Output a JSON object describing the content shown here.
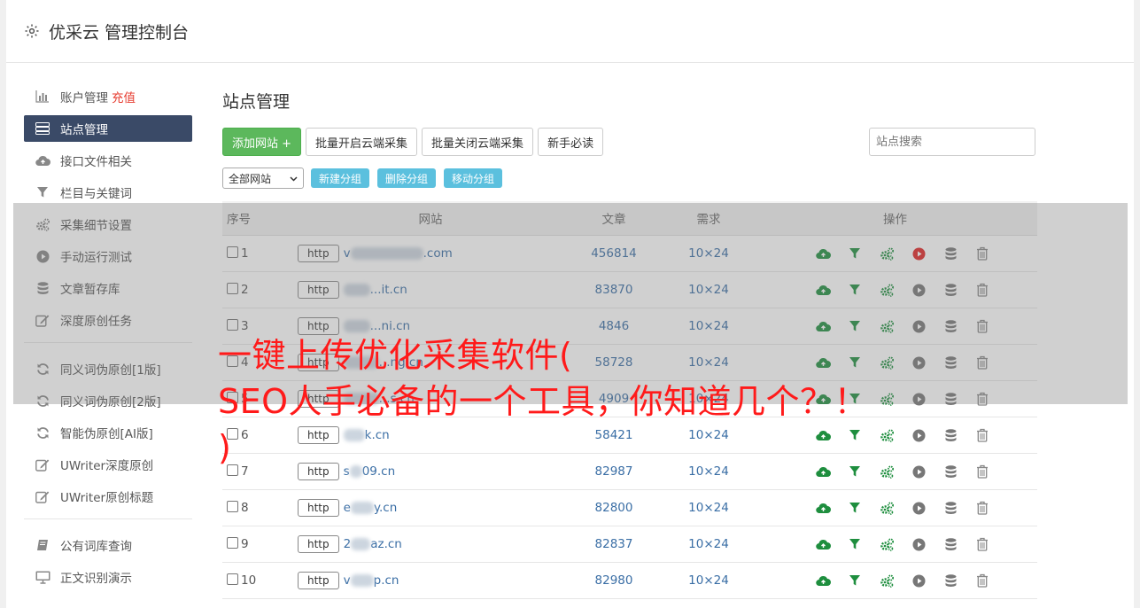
{
  "app": {
    "title": "优采云 管理控制台",
    "icon": "gear-icon"
  },
  "sidebar": {
    "groups": [
      [
        {
          "label": "账户管理",
          "tag": "充值",
          "icon": "bar-chart-icon"
        },
        {
          "label": "站点管理",
          "icon": "server-icon",
          "active": true
        },
        {
          "label": "接口文件相关",
          "icon": "cloud-upload-icon"
        },
        {
          "label": "栏目与关键词",
          "icon": "filter-icon"
        },
        {
          "label": "采集细节设置",
          "icon": "gears-icon"
        },
        {
          "label": "手动运行测试",
          "icon": "play-icon"
        },
        {
          "label": "文章暂存库",
          "icon": "database-icon"
        },
        {
          "label": "深度原创任务",
          "icon": "edit-icon"
        }
      ],
      [
        {
          "label": "同义词伪原创[1版]",
          "icon": "refresh-icon"
        },
        {
          "label": "同义词伪原创[2版]",
          "icon": "refresh-icon"
        },
        {
          "label": "智能伪原创[AI版]",
          "icon": "refresh-icon"
        },
        {
          "label": "UWriter深度原创",
          "icon": "edit-icon"
        },
        {
          "label": "UWriter原创标题",
          "icon": "edit-icon"
        }
      ],
      [
        {
          "label": "公有词库查询",
          "icon": "book-icon"
        },
        {
          "label": "正文识别演示",
          "icon": "monitor-icon"
        }
      ]
    ]
  },
  "main": {
    "title": "站点管理",
    "toolbar": {
      "add_label": "添加网站 +",
      "batch_open_label": "批量开启云端采集",
      "batch_close_label": "批量关闭云端采集",
      "guide_label": "新手必读",
      "search_placeholder": "站点搜索"
    },
    "group_select": "全部网站",
    "group_buttons": [
      "新建分组",
      "删除分组",
      "移动分组"
    ],
    "table": {
      "headers": [
        "序号",
        "网站",
        "文章",
        "需求",
        "操作"
      ],
      "rows": [
        {
          "no": "1",
          "prefix": "http",
          "url_a": "v",
          "url_b": ".com",
          "blur_w": 82,
          "articles": "456814",
          "need": "10×24",
          "run_active": true
        },
        {
          "no": "2",
          "prefix": "http",
          "url_a": "",
          "url_b": "...it.cn",
          "blur_w": 30,
          "articles": "83870",
          "need": "10×24",
          "run_active": false
        },
        {
          "no": "3",
          "prefix": "http",
          "url_a": "",
          "url_b": "...ni.cn",
          "blur_w": 30,
          "articles": "4846",
          "need": "10×24",
          "run_active": false
        },
        {
          "no": "4",
          "prefix": "http",
          "url_a": "",
          "url_b": "...ng.cn",
          "blur_w": 40,
          "articles": "58728",
          "need": "10×24",
          "run_active": false
        },
        {
          "no": "5",
          "prefix": "http",
          "url_a": "",
          "url_b": "...s.cn",
          "blur_w": 40,
          "articles": "4909",
          "need": "10×24",
          "run_active": false
        },
        {
          "no": "6",
          "prefix": "http",
          "url_a": "",
          "url_b": "k.cn",
          "blur_w": 24,
          "articles": "58421",
          "need": "10×24",
          "run_active": false
        },
        {
          "no": "7",
          "prefix": "http",
          "url_a": "s",
          "url_b": "09.cn",
          "blur_w": 14,
          "articles": "82987",
          "need": "10×24",
          "run_active": false
        },
        {
          "no": "8",
          "prefix": "http",
          "url_a": "e",
          "url_b": "y.cn",
          "blur_w": 26,
          "articles": "82800",
          "need": "10×24",
          "run_active": false
        },
        {
          "no": "9",
          "prefix": "http",
          "url_a": "2",
          "url_b": "az.cn",
          "blur_w": 22,
          "articles": "82837",
          "need": "10×24",
          "run_active": false
        },
        {
          "no": "10",
          "prefix": "http",
          "url_a": "v",
          "url_b": "p.cn",
          "blur_w": 26,
          "articles": "82980",
          "need": "10×24",
          "run_active": false
        }
      ],
      "op_icons": [
        "cloud-upload-icon",
        "filter-icon",
        "gears-icon",
        "play-icon",
        "database-icon",
        "trash-icon"
      ]
    }
  },
  "overlay_text": {
    "line1": "一键上传优化采集软件(",
    "line2": "SEO人手必备的一个工具，你知道几个？！",
    "line3": ")"
  },
  "colors": {
    "sidebar_active": "#3a4a67",
    "green": "#5cb85c",
    "info": "#5bc0de",
    "link": "#3a6ea5",
    "run_red": "#e02424",
    "icon_green": "#1e8e3e",
    "headline_red": "#ff1a1a"
  }
}
